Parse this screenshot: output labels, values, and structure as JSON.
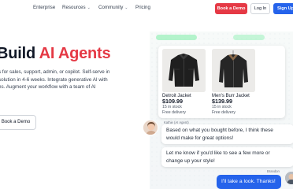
{
  "nav": {
    "links": [
      "Enterprise",
      "Resources",
      "Community",
      "Pricing"
    ],
    "book_demo": "Book a Demo",
    "login": "Log In",
    "signup": "Sign Up"
  },
  "hero": {
    "title_prefix": "Build ",
    "title_accent": "AI Agents",
    "desc_lines": [
      "s for sales, support, admin, or copilot. Self-serve in",
      "solution in 4-6 weeks. Integrate generative AI with",
      "ns. Augment your workflow with a team of AI"
    ],
    "cta": "Book a Demo"
  },
  "products": [
    {
      "name": "Detroit Jacket",
      "price": "$109.99",
      "stock": "15 in stock",
      "delivery": "Free delivery"
    },
    {
      "name": "Men's Burr Jacket",
      "price": "$139.99",
      "stock": "15 in stock",
      "delivery": "Free delivery"
    }
  ],
  "chat": {
    "agent_label": "Kathie (AI Agent)",
    "agent_messages": [
      [
        "Based on what you bought before, I think these",
        "would make for great options!"
      ],
      [
        "Let me know if you'd like to see a few more or",
        "change up your style!"
      ]
    ],
    "user_label": "Brandon",
    "user_message": "I'll take a look. Thanks!"
  },
  "colors": {
    "brand_red": "#e53945",
    "brand_blue": "#2563eb"
  },
  "icons": [
    "chevron-down-icon",
    "jacket-image",
    "avatar"
  ]
}
